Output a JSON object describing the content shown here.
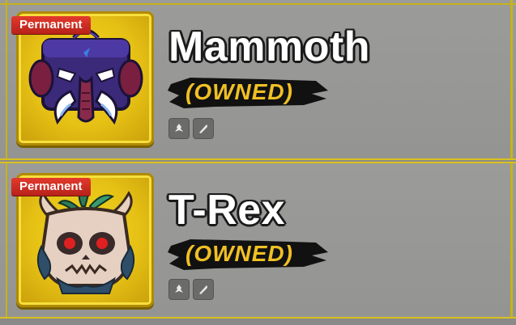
{
  "items": [
    {
      "name": "Mammoth",
      "badge": "Permanent",
      "status": "(OWNED)",
      "stat_icons": [
        "melee-icon",
        "blade-icon"
      ]
    },
    {
      "name": "T-Rex",
      "badge": "Permanent",
      "status": "(OWNED)",
      "stat_icons": [
        "melee-icon",
        "blade-icon"
      ]
    }
  ],
  "colors": {
    "frame_gold": "#d9c11c",
    "card_yellow": "#e6c115",
    "badge_red": "#c8281e",
    "owned_text": "#f0c024",
    "row_bg": "#999997"
  }
}
